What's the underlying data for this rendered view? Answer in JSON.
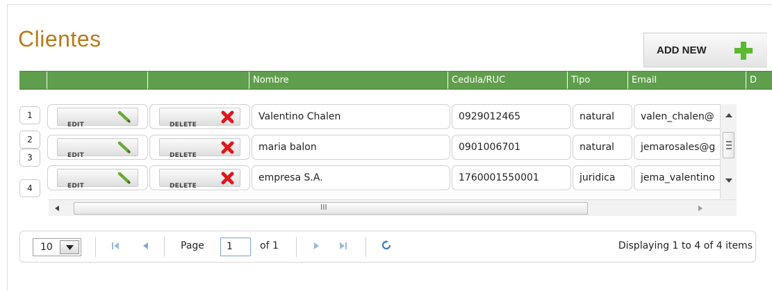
{
  "page": {
    "title": "Clientes"
  },
  "toolbar": {
    "add_new_label": "ADD NEW"
  },
  "table": {
    "columns": [
      "",
      "",
      "",
      "Nombre",
      "Cedula/RUC",
      "Tipo",
      "Email",
      "D"
    ],
    "row_numbers": [
      "1",
      "2",
      "3",
      "4"
    ],
    "edit_label": "EDIT",
    "delete_label": "DELETE",
    "rows": [
      {
        "nombre": "Valentino Chalen",
        "cedula": "0929012465",
        "tipo": "natural",
        "email": "valen_chalen@"
      },
      {
        "nombre": "maria balon",
        "cedula": "0901006701",
        "tipo": "natural",
        "email": "jemarosales@g"
      },
      {
        "nombre": "empresa S.A.",
        "cedula": "1760001550001",
        "tipo": "juridica",
        "email": "jema_valentino"
      }
    ]
  },
  "scroll": {
    "thumb_grip": "III"
  },
  "pager": {
    "page_size": "10",
    "page_label": "Page",
    "current_page": "1",
    "of_label": "of 1",
    "display_text": "Displaying 1 to 4 of 4 items"
  },
  "colors": {
    "accent_green": "#5f9e4c",
    "title_color": "#b8791a",
    "delete_red": "#e0161b",
    "edit_green": "#6aa83a"
  }
}
